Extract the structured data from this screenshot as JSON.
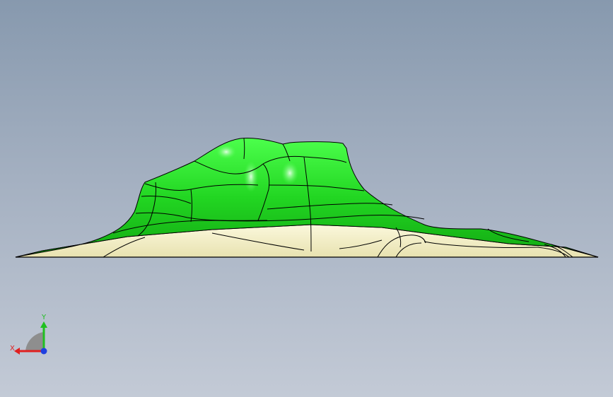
{
  "viewport": {
    "background_top": "#8799ae",
    "background_bottom": "#c3cad6"
  },
  "model": {
    "top_surface_color": "#22d622",
    "underside_color": "#f5f1c8",
    "edge_color": "#000000"
  },
  "triad": {
    "y_label": "Y",
    "x_label": "X",
    "x_color": "#e02020",
    "y_color": "#20c020",
    "z_color": "#2040e0"
  }
}
